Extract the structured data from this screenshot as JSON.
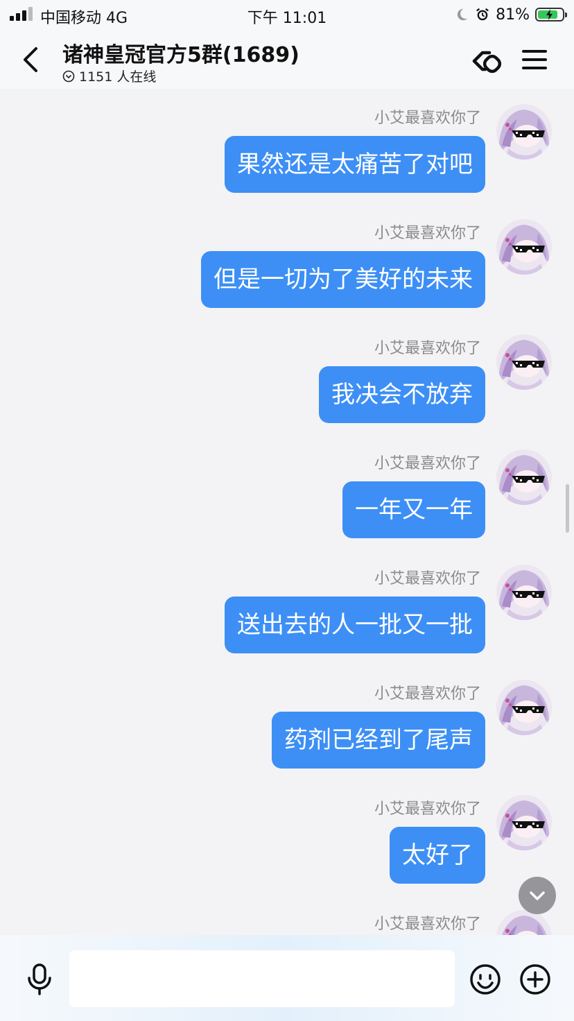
{
  "status_bar": {
    "carrier": "中国移动   4G",
    "time": "下午 11:01",
    "battery_percent": "81%",
    "battery_level": 0.81
  },
  "header": {
    "title": "诸神皇冠官方5群(1689)",
    "online_text": "1151 人在线"
  },
  "messages": [
    {
      "sender": "小艾最喜欢你了",
      "text": "果然还是太痛苦了对吧"
    },
    {
      "sender": "小艾最喜欢你了",
      "text": "但是一切为了美好的未来"
    },
    {
      "sender": "小艾最喜欢你了",
      "text": "我决会不放弃"
    },
    {
      "sender": "小艾最喜欢你了",
      "text": "一年又一年"
    },
    {
      "sender": "小艾最喜欢你了",
      "text": "送出去的人一批又一批"
    },
    {
      "sender": "小艾最喜欢你了",
      "text": "药剂已经到了尾声"
    },
    {
      "sender": "小艾最喜欢你了",
      "text": "太好了"
    },
    {
      "sender": "小艾最喜欢你了",
      "text": ""
    }
  ],
  "input": {
    "value": "",
    "placeholder": ""
  },
  "icons": {
    "back": "chevron-left-icon",
    "link": "link-icon",
    "menu": "menu-icon",
    "mic": "microphone-icon",
    "emoji": "emoji-icon",
    "plus": "plus-icon",
    "scroll_down": "chevron-down-icon"
  },
  "colors": {
    "bubble": "#3d8ff5",
    "bubble_text": "#ffffff",
    "sender_name": "#8a8a8e",
    "background": "#f3f3f5"
  }
}
